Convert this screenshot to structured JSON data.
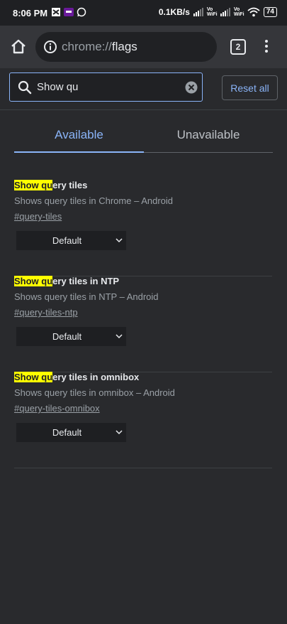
{
  "status_bar": {
    "time": "8:06 PM",
    "net_speed": "0.1KB/s",
    "volte1": "Vo WiFi",
    "volte2": "Vo WiFi",
    "battery": "74"
  },
  "toolbar": {
    "url_scheme": "chrome://",
    "url_path": "flags",
    "tab_count": "2"
  },
  "search": {
    "value": "Show qu",
    "reset_label": "Reset all"
  },
  "tabs": [
    {
      "label": "Available",
      "selected": true
    },
    {
      "label": "Unavailable",
      "selected": false
    }
  ],
  "experiments": [
    {
      "title_highlight": "Show qu",
      "title_rest": "ery tiles",
      "description": "Shows query tiles in Chrome – Android",
      "link": "#query-tiles",
      "value": "Default"
    },
    {
      "title_highlight": "Show qu",
      "title_rest": "ery tiles in NTP",
      "description": "Shows query tiles in NTP – Android",
      "link": "#query-tiles-ntp",
      "value": "Default"
    },
    {
      "title_highlight": "Show qu",
      "title_rest": "ery tiles in omnibox",
      "description": "Shows query tiles in omnibox – Android",
      "link": "#query-tiles-omnibox",
      "value": "Default"
    }
  ],
  "colors": {
    "background": "#292a2d",
    "accent": "#8ab4f8",
    "highlight": "#ffff00"
  }
}
